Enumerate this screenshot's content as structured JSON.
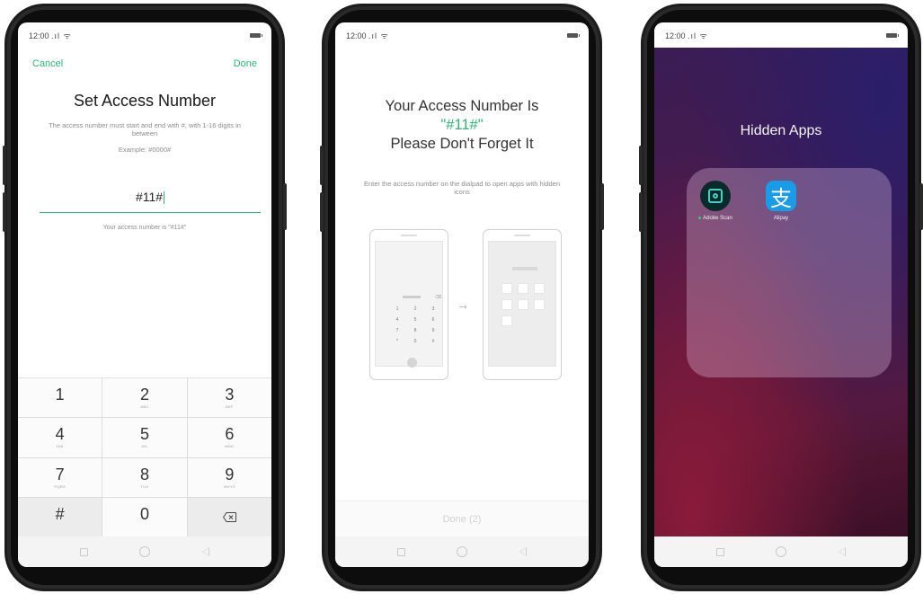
{
  "screen1": {
    "status_time": "12:00",
    "header": {
      "cancel_label": "Cancel",
      "done_label": "Done"
    },
    "title": "Set Access Number",
    "description": "The access number must start and end with #, with 1-16 digits in between",
    "example": "Example: #0000#",
    "input_value": "#11#",
    "hint": "Your access number is \"#11#\"",
    "keypad": [
      {
        "digit": "1",
        "letters": ""
      },
      {
        "digit": "2",
        "letters": "ABC"
      },
      {
        "digit": "3",
        "letters": "DEF"
      },
      {
        "digit": "4",
        "letters": "GHI"
      },
      {
        "digit": "5",
        "letters": "JKL"
      },
      {
        "digit": "6",
        "letters": "MNO"
      },
      {
        "digit": "7",
        "letters": "PQRS"
      },
      {
        "digit": "8",
        "letters": "TUV"
      },
      {
        "digit": "9",
        "letters": "WXYZ"
      },
      {
        "digit": "#",
        "letters": ""
      },
      {
        "digit": "0",
        "letters": ""
      }
    ]
  },
  "screen2": {
    "status_time": "12:00",
    "title_line1": "Your Access Number Is",
    "title_number": "\"#11#\"",
    "title_line3": "Please Don't Forget It",
    "description": "Enter the access number on the dialpad to open apps with hidden icons",
    "dial_digits": [
      "1",
      "2",
      "3",
      "4",
      "5",
      "6",
      "7",
      "8",
      "9",
      "*",
      "0",
      "#"
    ],
    "arrow": "→",
    "done_label": "Done (2)"
  },
  "screen3": {
    "status_time": "12:00",
    "title": "Hidden Apps",
    "apps": [
      {
        "label": "Adobe Scan",
        "icon": "adobe-scan-icon",
        "color": "#0b2a2c",
        "new": true
      },
      {
        "label": "Alipay",
        "icon": "alipay-icon",
        "color": "#1a9be8",
        "glyph": "支",
        "new": false
      }
    ]
  },
  "colors": {
    "accent": "#2bb673"
  }
}
